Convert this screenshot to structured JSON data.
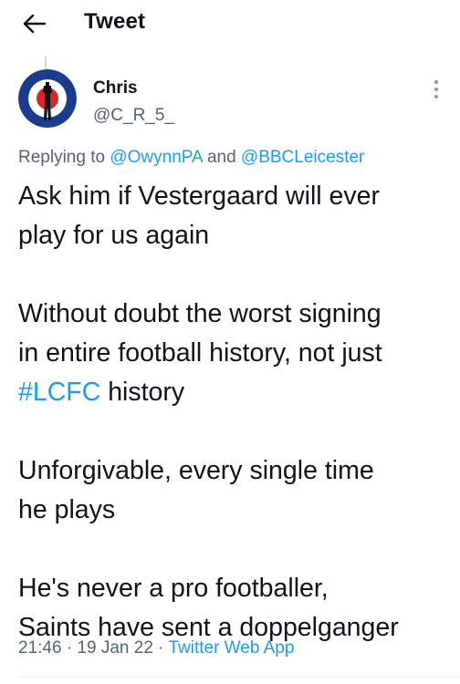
{
  "header": {
    "title": "Tweet"
  },
  "tweet": {
    "author": {
      "name": "Chris",
      "handle": "@C_R_5_"
    },
    "reply_context": {
      "prefix": "Replying to",
      "mentions": [
        "@OwynnPA",
        "@BBCLeicester"
      ],
      "conjunction": "and"
    },
    "body": {
      "p1_line1": "Ask him if Vestergaard will ever",
      "p1_line2": "play for us again",
      "p2_line1": "Without doubt the worst signing",
      "p2_line2": "in entire football history, not just",
      "p2_hashtag": "#LCFC",
      "p2_line3_rest": " history",
      "p3_line1": "Unforgivable, every single time",
      "p3_line2": "he plays",
      "p4_line1": "He's never a pro footballer,",
      "p4_line2": "Saints have sent a doppelganger"
    },
    "meta": {
      "time": "21:46",
      "separator": " · ",
      "date": "19 Jan 22",
      "source": "Twitter Web App"
    }
  },
  "icons": {
    "back": "arrow-left-icon",
    "more": "more-vertical-icon"
  },
  "colors": {
    "text": "#0f1419",
    "secondary": "#536471",
    "link": "#1d9bf0",
    "avatar_outer": "#1b3c8c",
    "avatar_ring": "#ffffff",
    "avatar_inner": "#d7262b"
  }
}
